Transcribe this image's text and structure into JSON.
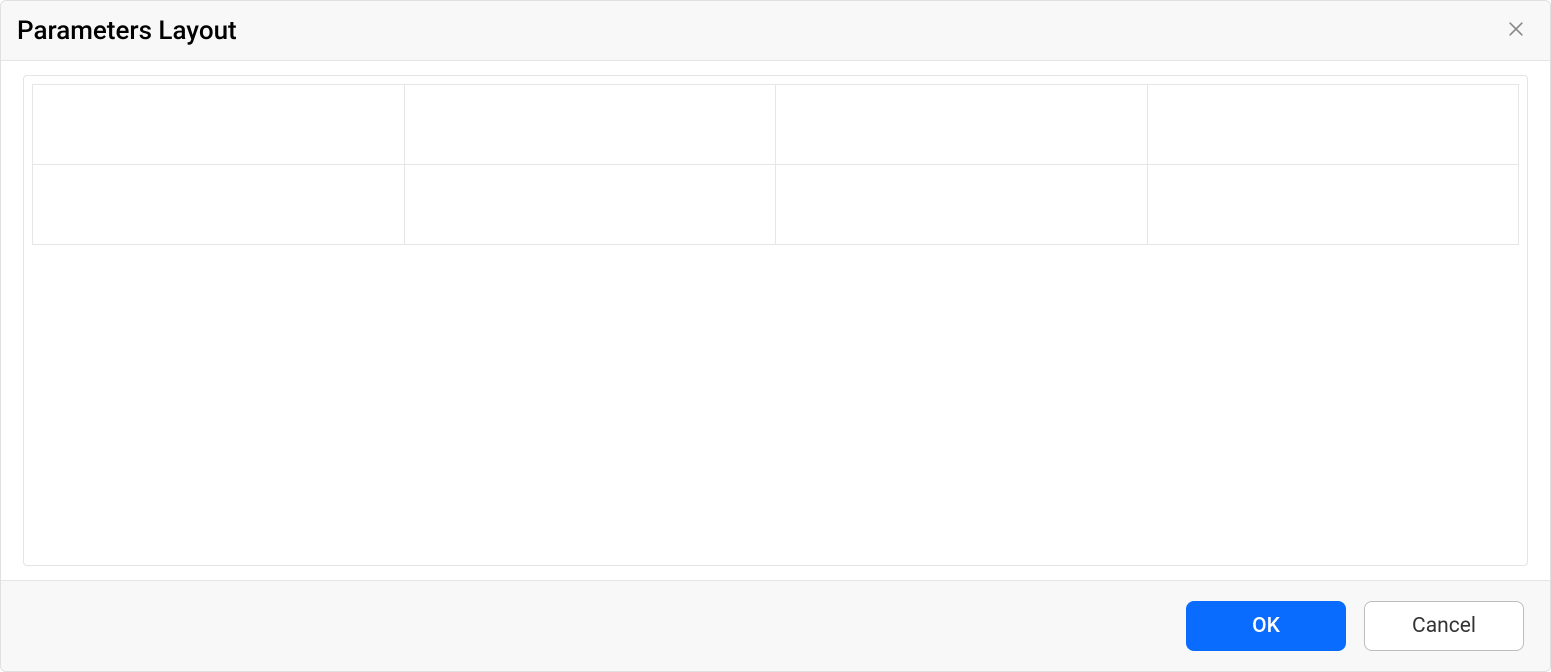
{
  "dialog": {
    "title": "Parameters Layout",
    "grid": {
      "rows": 2,
      "cols": 4,
      "cells": [
        {
          "r": 0,
          "c": 0,
          "value": ""
        },
        {
          "r": 0,
          "c": 1,
          "value": ""
        },
        {
          "r": 0,
          "c": 2,
          "value": ""
        },
        {
          "r": 0,
          "c": 3,
          "value": ""
        },
        {
          "r": 1,
          "c": 0,
          "value": ""
        },
        {
          "r": 1,
          "c": 1,
          "value": ""
        },
        {
          "r": 1,
          "c": 2,
          "value": ""
        },
        {
          "r": 1,
          "c": 3,
          "value": ""
        }
      ]
    },
    "footer": {
      "ok_label": "OK",
      "cancel_label": "Cancel"
    }
  }
}
